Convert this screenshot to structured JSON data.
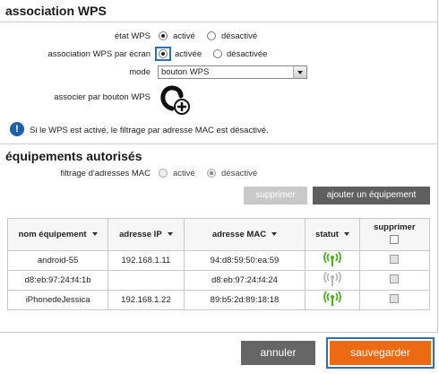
{
  "wps": {
    "title": "association WPS",
    "etat_label": "état WPS",
    "etat_on": "activé",
    "etat_off": "désactivé",
    "ecran_label": "association WPS par écran",
    "ecran_on": "activée",
    "ecran_off": "désactivée",
    "mode_label": "mode",
    "mode_value": "bouton WPS",
    "bouton_label": "associer par bouton WPS",
    "info": "Si le WPS est activé, le filtrage par adresse MAC est désactivé."
  },
  "equipements": {
    "title": "équipements autorisés",
    "filtrage_label": "filtrage d'adresses MAC",
    "filtrage_on": "activé",
    "filtrage_off": "désactivé",
    "supprimer_btn": "supprimer",
    "ajouter_btn": "ajouter un équipement",
    "columns": [
      "nom équipement",
      "adresse IP",
      "adresse MAC",
      "statut",
      "supprimer"
    ],
    "rows": [
      {
        "nom": "android-55",
        "ip": "192.168.1.11",
        "mac": "94:d8:59:50:ea:59",
        "status": "connected"
      },
      {
        "nom": "d8:eb:97:24:f4:1b",
        "ip": "",
        "mac": "d8:eb:97:24:f4:24",
        "status": "disconnected"
      },
      {
        "nom": "iPhonedeJessica",
        "ip": "192.168.1.22",
        "mac": "89:b5:2d:89:18:18",
        "status": "connected"
      }
    ]
  },
  "footer": {
    "annuler": "annuler",
    "sauvegarder": "sauvegarder"
  },
  "colors": {
    "accent_orange": "#ec6a12",
    "focus_blue": "#2e6fb5",
    "wifi_on": "#4caf1e",
    "wifi_off": "#b8b8b8"
  }
}
